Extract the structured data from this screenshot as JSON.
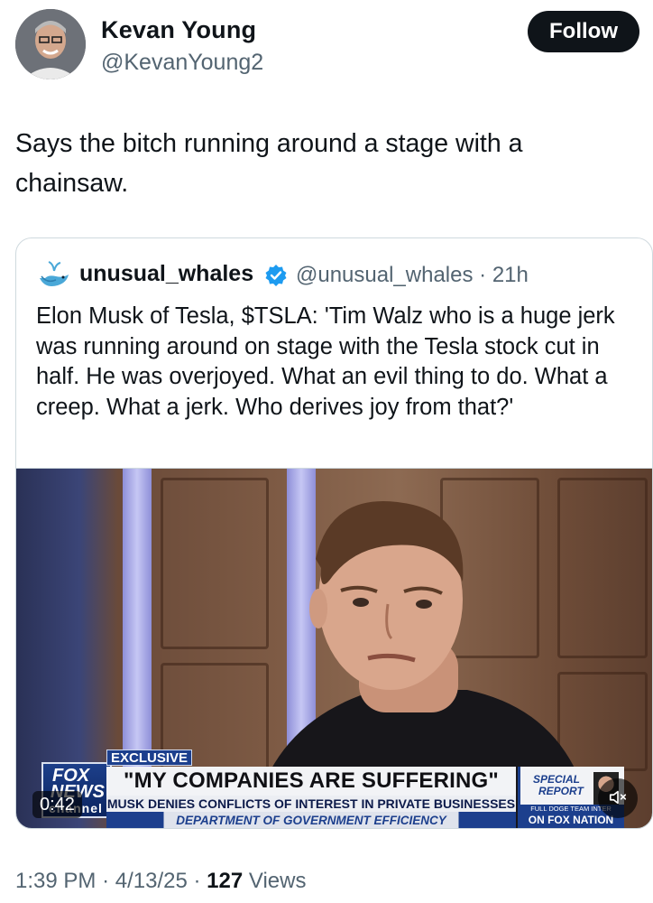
{
  "author": {
    "display_name": "Kevan Young",
    "handle": "@KevanYoung2",
    "avatar_icon": "profile-photo"
  },
  "follow_label": "Follow",
  "tweet_text": "Says the bitch running around a stage with a chainsaw.",
  "quoted": {
    "name": "unusual_whales",
    "handle_time": "@unusual_whales · 21h",
    "verified_color": "#1d9bf0",
    "text": "Elon Musk of Tesla, $TSLA: 'Tim Walz who is a huge jerk was running around on stage with the Tesla stock cut in half. He was overjoyed. What an evil thing to do. What a creep. What a jerk. Who derives joy from that?'",
    "video": {
      "duration": "0:42",
      "chyron": {
        "tag": "EXCLUSIVE",
        "headline": "\"MY COMPANIES ARE SUFFERING\"",
        "subline": "MUSK DENIES CONFLICTS OF INTEREST IN PRIVATE BUSINESSES",
        "ticker": "DEPARTMENT OF GOVERNMENT EFFICIENCY",
        "special_line1": "SPECIAL",
        "special_line2": "REPORT",
        "promo_top": "FULL DOGE TEAM INTER",
        "promo": "ON FOX NATION",
        "logo_line1": "FOX",
        "logo_line2": "NEWS",
        "logo_line3": "channel"
      }
    }
  },
  "meta": {
    "time": "1:39 PM",
    "date": "4/13/25",
    "views_count": "127",
    "views_label": "Views"
  }
}
